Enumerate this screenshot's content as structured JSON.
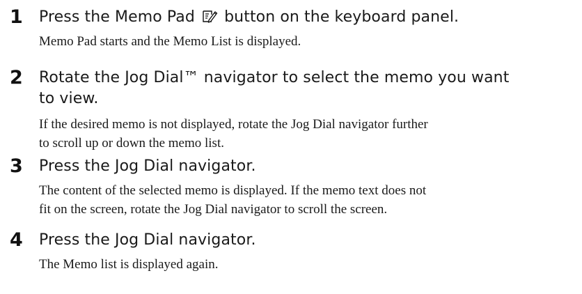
{
  "steps": [
    {
      "number": "1",
      "heading_before": "Press the Memo Pad",
      "heading_after": "button on the keyboard panel.",
      "icon": "memo-pad-pen-icon",
      "body": "Memo Pad starts and the Memo List is displayed."
    },
    {
      "number": "2",
      "heading_line1": "Rotate the Jog Dial™ navigator to select the memo you want",
      "heading_line2": "to view.",
      "body_line1": "If the desired memo is not displayed, rotate the Jog Dial navigator further",
      "body_line2": "to scroll up or down the memo list."
    },
    {
      "number": "3",
      "heading": "Press the Jog Dial navigator.",
      "body_line1": "The content of the selected memo is displayed. If the memo text does not",
      "body_line2": "fit on the screen, rotate the Jog Dial navigator to scroll the screen."
    },
    {
      "number": "4",
      "heading": "Press the Jog Dial navigator.",
      "body": "The Memo list is displayed again."
    }
  ]
}
